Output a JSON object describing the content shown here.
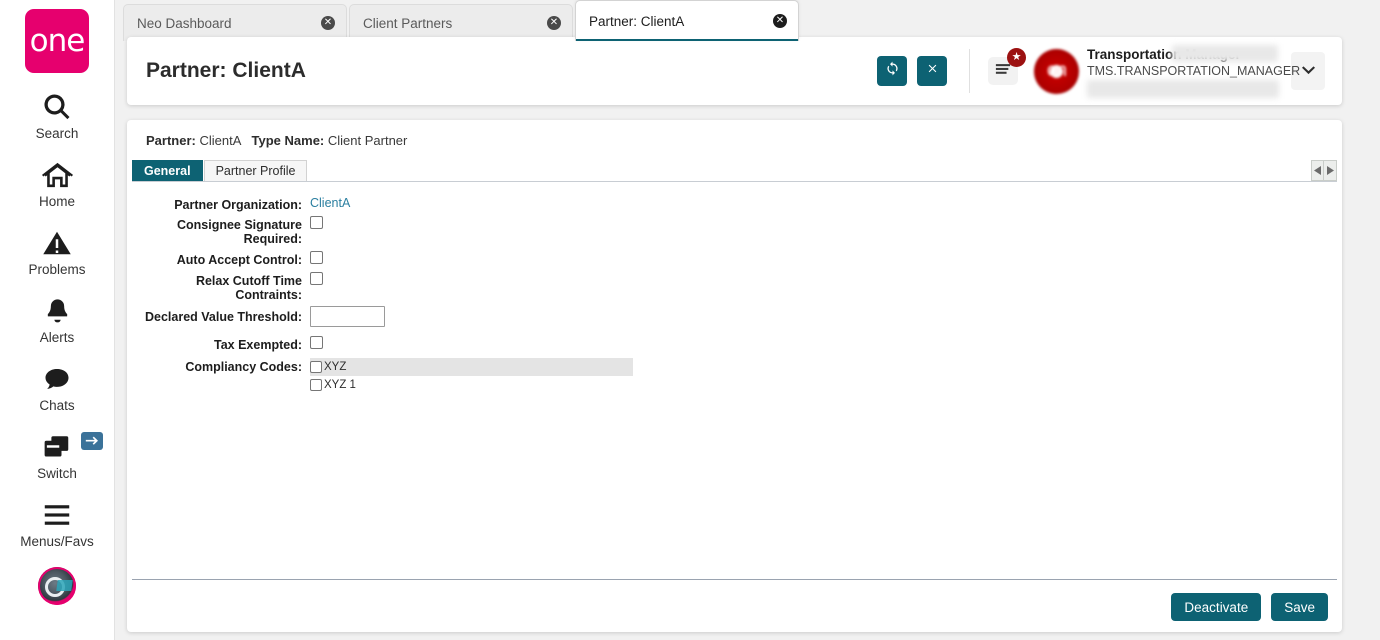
{
  "sidebar": {
    "logo_text": "one",
    "items": [
      {
        "label": "Search",
        "icon": "search-icon"
      },
      {
        "label": "Home",
        "icon": "home-icon"
      },
      {
        "label": "Problems",
        "icon": "warning-triangle-icon"
      },
      {
        "label": "Alerts",
        "icon": "bell-icon"
      },
      {
        "label": "Chats",
        "icon": "chat-bubble-icon"
      },
      {
        "label": "Switch",
        "icon": "windows-stack-icon",
        "badge_icon": "swap-arrows-icon"
      },
      {
        "label": "Menus/Favs",
        "icon": "hamburger-icon"
      }
    ],
    "avatar_name": "bot-avatar"
  },
  "tabs": [
    {
      "label": "Neo Dashboard",
      "active": false,
      "close": "✕"
    },
    {
      "label": "Client Partners",
      "active": false,
      "close": "✕"
    },
    {
      "label": "Partner: ClientA",
      "active": true,
      "close": "✕"
    }
  ],
  "header": {
    "title": "Partner: ClientA",
    "refresh_icon": "refresh-icon",
    "close_icon": "close-x-icon",
    "menu_fav_icon": "hamburger-icon",
    "menu_fav_badge_icon": "star-icon",
    "badge_glyph": "★",
    "avatar_text": "on",
    "user_name": "Transportation Manager",
    "user_role": "TMS.TRANSPORTATION_MANAGER",
    "caret_glyph": "⌄"
  },
  "breadcrumb": {
    "partner_label": "Partner:",
    "partner_value": "ClientA",
    "type_label": "Type Name:",
    "type_value": "Client Partner"
  },
  "section_tabs": [
    {
      "label": "General",
      "active": true
    },
    {
      "label": "Partner Profile",
      "active": false
    }
  ],
  "scroll": {
    "left_glyph": "◀",
    "right_glyph": "▶"
  },
  "form": {
    "partner_org": {
      "label": "Partner Organization:",
      "value": "ClientA"
    },
    "consignee_sig": {
      "label": "Consignee Signature Required:",
      "checked": false
    },
    "auto_accept": {
      "label": "Auto Accept Control:",
      "checked": false
    },
    "relax_cutoff": {
      "label": "Relax Cutoff Time Contraints:",
      "checked": false
    },
    "declared_value": {
      "label": "Declared Value Threshold:",
      "value": "",
      "placeholder": ""
    },
    "tax_exempted": {
      "label": "Tax Exempted:",
      "checked": false
    },
    "compliancy": {
      "label": "Compliancy Codes:",
      "options": [
        {
          "label": "XYZ",
          "checked": false,
          "highlighted": true
        },
        {
          "label": "XYZ 1",
          "checked": false,
          "highlighted": false
        }
      ]
    }
  },
  "footer": {
    "deactivate_label": "Deactivate",
    "save_label": "Save"
  },
  "colors": {
    "brand_pink": "#e6006e",
    "accent_teal": "#0d6273",
    "badge_red": "#9c1111",
    "link_blue": "#2b7fa0"
  }
}
